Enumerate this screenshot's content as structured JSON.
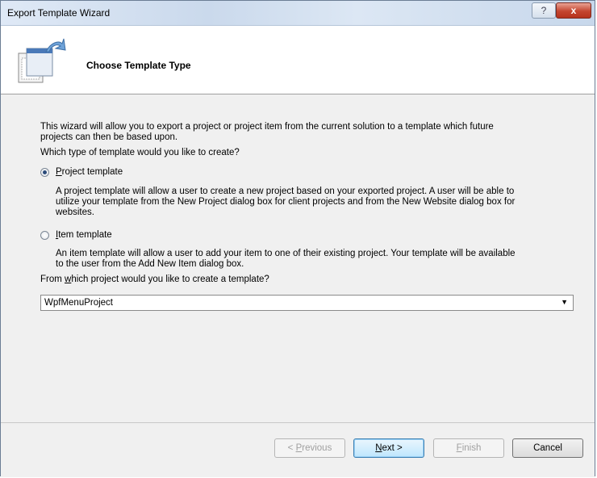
{
  "window": {
    "title": "Export Template Wizard",
    "help_label": "?",
    "close_label": "x"
  },
  "header": {
    "title": "Choose Template Type"
  },
  "content": {
    "intro_line1": "This wizard will allow you to export a project or project item from the current solution to a template which future",
    "intro_line2": "projects can then be based upon.",
    "question": "Which type of template would you like to create?",
    "project_option": {
      "label_mnemonic": "P",
      "label_rest": "roject template",
      "selected": true,
      "desc_line1": "A project template will allow a user to create a new project based on your exported project. A user will be able to",
      "desc_line2": "utilize your template from the New Project dialog box for client projects and from the New Website dialog box for",
      "desc_line3": "websites."
    },
    "item_option": {
      "label_mnemonic": "I",
      "label_rest": "tem template",
      "selected": false,
      "desc_line1": "An item template will allow a user to add your item to one of their existing project. Your template will be available",
      "desc_line2": "to the user from the Add New Item dialog box."
    },
    "project_question_pre": "From ",
    "project_question_mnemonic": "w",
    "project_question_rest": "hich project would you like to create a template?",
    "project_select": {
      "value": "WpfMenuProject"
    }
  },
  "buttons": {
    "previous_pre": "< ",
    "previous_mnemonic": "P",
    "previous_rest": "revious",
    "next_mnemonic": "N",
    "next_rest": "ext >",
    "finish_mnemonic": "F",
    "finish_rest": "inish",
    "cancel": "Cancel"
  }
}
